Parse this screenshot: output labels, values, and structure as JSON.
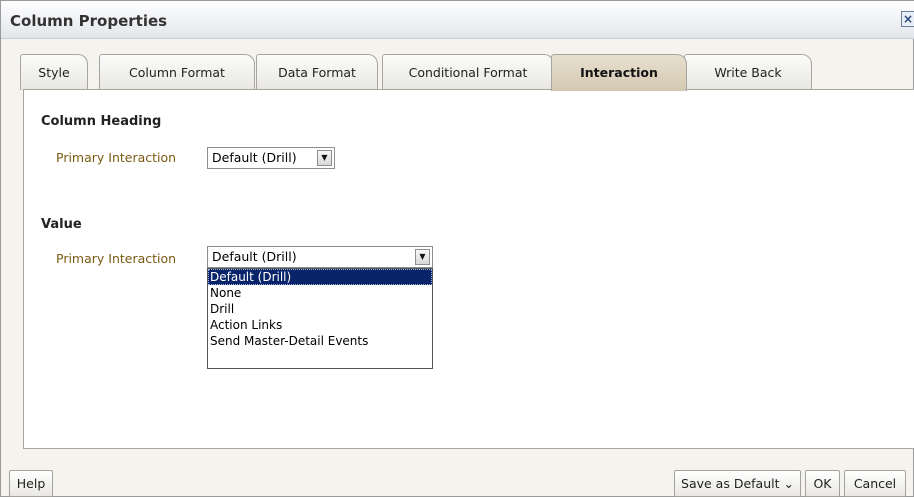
{
  "dialog": {
    "title": "Column Properties",
    "close_glyph": "×",
    "close_icon": "close-icon"
  },
  "tabs": [
    {
      "label": "Style",
      "active": false
    },
    {
      "label": "Column Format",
      "active": false
    },
    {
      "label": "Data Format",
      "active": false
    },
    {
      "label": "Conditional Format",
      "active": false
    },
    {
      "label": "Interaction",
      "active": true
    },
    {
      "label": "Write Back",
      "active": false
    }
  ],
  "column_heading": {
    "title": "Column Heading",
    "primary_interaction_label": "Primary Interaction",
    "primary_interaction_value": "Default (Drill)"
  },
  "value": {
    "title": "Value",
    "primary_interaction_label": "Primary Interaction",
    "primary_interaction_value": "Default (Drill)",
    "options": [
      {
        "label": "Default (Drill)",
        "selected": true
      },
      {
        "label": "None",
        "selected": false
      },
      {
        "label": "Drill",
        "selected": false
      },
      {
        "label": "Action Links",
        "selected": false
      },
      {
        "label": "Send Master-Detail Events",
        "selected": false
      }
    ]
  },
  "dropdown_arrow_glyph": "▼",
  "footer": {
    "help": "Help",
    "save_as_default": "Save as Default",
    "save_chevron": "⌄",
    "ok": "OK",
    "cancel": "Cancel"
  },
  "colors": {
    "label": "#7b5a13",
    "selection": "#0a246a",
    "active_tab": "#d3c8b2"
  }
}
